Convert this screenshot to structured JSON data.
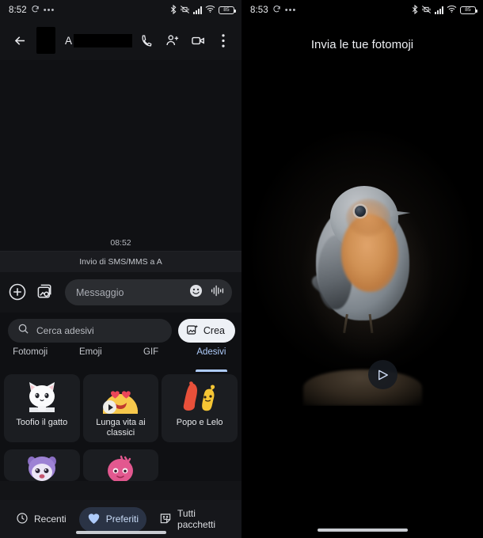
{
  "left_phone": {
    "status_bar": {
      "time": "8:52",
      "battery_level": "85",
      "icons": [
        "sync-icon",
        "more-dots-icon",
        "bluetooth-icon",
        "vibrate-off-icon",
        "signal-icon",
        "wifi-icon",
        "battery-icon"
      ]
    },
    "conversation_bar": {
      "back_label": "",
      "contact_name": "A",
      "actions": [
        "call-icon",
        "add-person-icon",
        "video-call-icon",
        "overflow-menu-icon"
      ]
    },
    "thread": {
      "timestamp": "08:52",
      "sending_note": "Invio di SMS/MMS a A"
    },
    "composer": {
      "placeholder": "Messaggio",
      "attach_label": "+",
      "icons": [
        "plus-icon",
        "gallery-icon",
        "emoji-icon",
        "voice-icon"
      ]
    },
    "sticker_panel": {
      "search_placeholder": "Cerca adesivi",
      "create_label": "Crea",
      "tabs": [
        {
          "label": "Fotomoji",
          "selected": false
        },
        {
          "label": "Emoji",
          "selected": false
        },
        {
          "label": "GIF",
          "selected": false
        },
        {
          "label": "Adesivi",
          "selected": true
        }
      ],
      "packs": [
        {
          "label": "Toofio il gatto",
          "art": "white-cat",
          "has_play": false
        },
        {
          "label": "Lunga vita ai classici",
          "art": "heart-eyes-emoji",
          "has_play": true
        },
        {
          "label": "Popo e Lelo",
          "art": "red-yellow-creatures",
          "has_play": false
        }
      ],
      "packs_partial": [
        {
          "art": "purple-creature"
        },
        {
          "art": "pink-creature"
        }
      ],
      "bottom_nav": [
        {
          "label": "Recenti",
          "icon": "clock-icon",
          "selected": false
        },
        {
          "label": "Preferiti",
          "icon": "heart-icon",
          "selected": true
        },
        {
          "label": "Tutti pacchetti",
          "icon": "sticker-icon",
          "selected": false
        }
      ]
    }
  },
  "right_phone": {
    "status_bar": {
      "time": "8:53",
      "battery_level": "85"
    },
    "title": "Invia le tue fotomoji",
    "photo": {
      "subject": "robin-bird-photo"
    },
    "send_button_label": "send-icon"
  },
  "colors": {
    "accent_blue": "#aecbfa",
    "chip_bg": "#2a3345",
    "panel_bg": "#0f1013",
    "create_btn_bg": "#eef1f6"
  }
}
